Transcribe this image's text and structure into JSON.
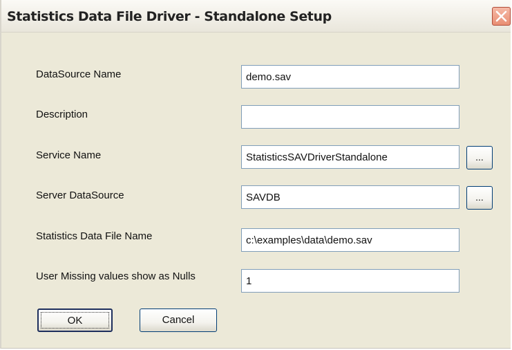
{
  "window": {
    "title": "Statistics Data File Driver - Standalone Setup",
    "close_icon": "close-icon"
  },
  "fields": [
    {
      "label": "DataSource Name",
      "value": "demo.sav"
    },
    {
      "label": "Description",
      "value": ""
    },
    {
      "label": "Service Name",
      "value": "StatisticsSAVDriverStandalone",
      "browse_label": "..."
    },
    {
      "label": "Server DataSource",
      "value": "SAVDB",
      "browse_label": "..."
    },
    {
      "label": "Statistics Data File Name",
      "value": "c:\\examples\\data\\demo.sav"
    },
    {
      "label": "User Missing values show as Nulls",
      "value": "1"
    }
  ],
  "buttons": {
    "ok_label": "OK",
    "cancel_label": "Cancel"
  },
  "colors": {
    "dialog_background": "#ece9d8",
    "close_button": "#e98f74",
    "input_border": "#7f9db9"
  }
}
